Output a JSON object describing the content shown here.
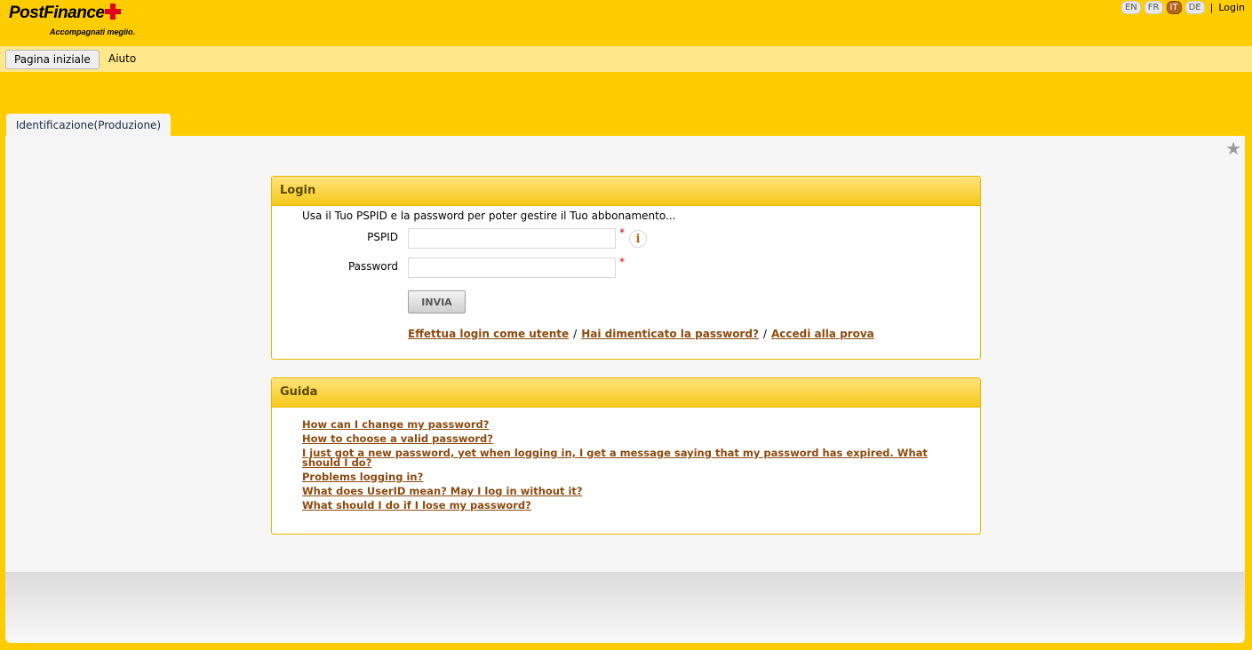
{
  "header": {
    "logo_name": "PostFinance",
    "logo_tagline": "Accompagnati meglio.",
    "languages": [
      "EN",
      "FR",
      "IT",
      "DE"
    ],
    "active_language": "IT",
    "separator": "|",
    "login_label": "Login"
  },
  "menu": {
    "items": [
      {
        "label": "Pagina iniziale",
        "active": true
      },
      {
        "label": "Aiuto",
        "active": false
      }
    ]
  },
  "tab": {
    "label": "Identificazione(Produzione)"
  },
  "login": {
    "title": "Login",
    "intro": "Usa il Tuo PSPID e la password per poter gestire il Tuo abbonamento...",
    "pspid_label": "PSPID",
    "pspid_value": "",
    "password_label": "Password",
    "password_value": "",
    "required_mark": "*",
    "info_icon_glyph": "i",
    "submit_label": "INVIA",
    "links": [
      "Effettua login come utente",
      "Hai dimenticato la password?",
      "Accedi alla prova"
    ],
    "link_separator": "/"
  },
  "guide": {
    "title": "Guida",
    "items": [
      "How can I change my password?",
      "How to choose a valid password?",
      "I just got a new password, yet when logging in, I get a message saying that my password has expired. What should I do?",
      "Problems logging in?",
      "What does UserID mean? May I log in without it?",
      "What should I do if I lose my password?"
    ]
  },
  "colors": {
    "background": "#ffcc00",
    "menubar": "#ffe88a",
    "box_header": "#f7c91a",
    "link": "#8b4a0f",
    "required": "#cc0000",
    "active_language": "#b5651d"
  },
  "icons": {
    "favorite": "star-icon",
    "info": "info-icon",
    "logo_cross": "swiss-cross-icon"
  }
}
